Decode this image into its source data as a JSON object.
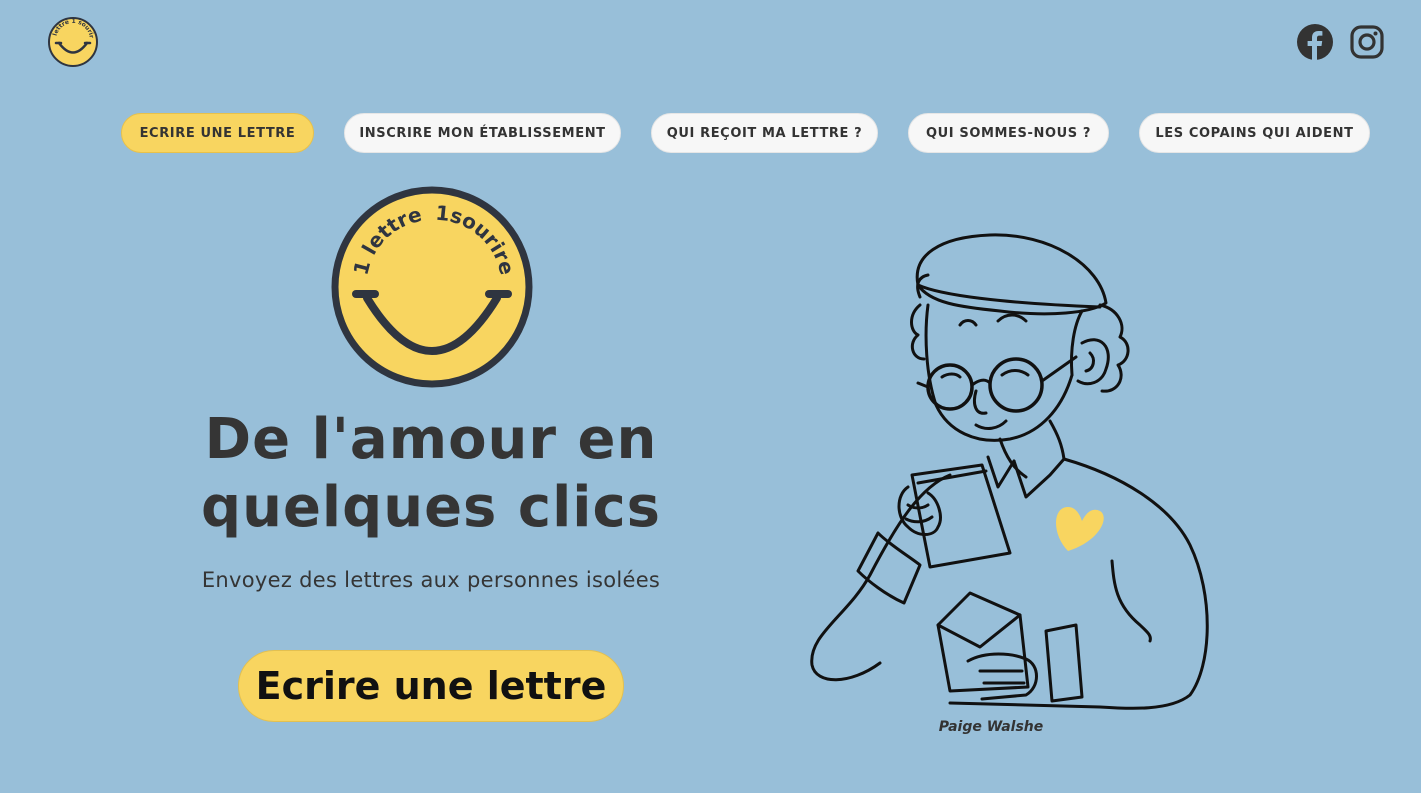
{
  "header": {
    "logo_text": "1 lettre 1 sourire",
    "social": [
      {
        "icon": "facebook-icon"
      },
      {
        "icon": "instagram-icon"
      }
    ]
  },
  "nav": {
    "items": [
      {
        "label": "ECRIRE UNE LETTRE",
        "active": true
      },
      {
        "label": "INSCRIRE MON ÉTABLISSEMENT",
        "active": false
      },
      {
        "label": "QUI REÇOIT MA LETTRE ?",
        "active": false
      },
      {
        "label": "QUI SOMMES-NOUS ?",
        "active": false
      },
      {
        "label": "LES COPAINS QUI AIDENT",
        "active": false
      }
    ]
  },
  "hero": {
    "logo_text_left": "1 lettre",
    "logo_text_right": "1sourire",
    "headline_line1": "De l'amour en",
    "headline_line2": "quelques clics",
    "subline": "Envoyez des lettres aux personnes isolées",
    "cta_label": "Ecrire une lettre"
  },
  "illustration": {
    "credit": "Paige Walshe"
  },
  "colors": {
    "background": "#98bfd9",
    "accent_yellow": "#f8d560",
    "text_dark": "#353535",
    "nav_bg": "#f7f7f7"
  }
}
